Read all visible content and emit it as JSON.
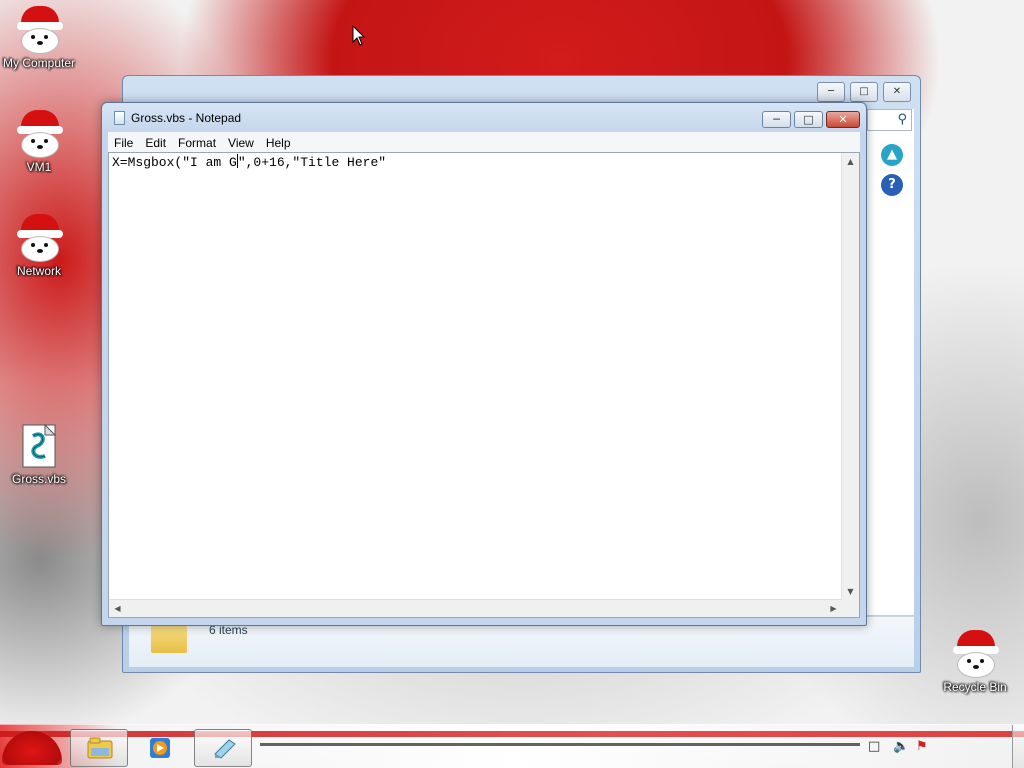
{
  "desktop": {
    "icons": [
      {
        "label": "My Computer"
      },
      {
        "label": "VM1"
      },
      {
        "label": "Network"
      },
      {
        "label": "Gross.vbs"
      },
      {
        "label": "Recycle Bin"
      }
    ]
  },
  "explorer": {
    "status_count": "6 items",
    "search_icon": "magnifier-icon",
    "help_glyph": "?"
  },
  "notepad": {
    "title": "Gross.vbs - Notepad",
    "menu": [
      "File",
      "Edit",
      "Format",
      "View",
      "Help"
    ],
    "content_before_caret": "X=Msgbox(\"I am G",
    "content_after_caret": "\",0+16,\"Title Here\"",
    "controls": {
      "minimize": "minimize-icon",
      "maximize": "maximize-icon",
      "close": "close-icon"
    }
  },
  "colors": {
    "accent_red": "#d21b1b",
    "window_frame": "#c4d6ec",
    "close_red": "#c74a33"
  }
}
